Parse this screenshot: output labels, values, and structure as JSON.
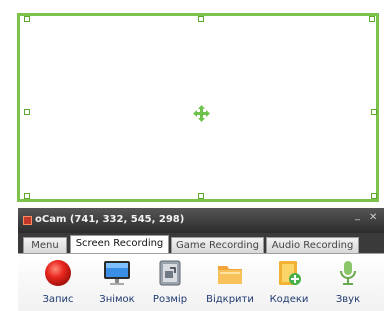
{
  "window": {
    "title": "oCam (741, 332, 545, 298)",
    "minimize_glyph": "_",
    "close_glyph": "✕"
  },
  "tabs": [
    {
      "label": "Menu"
    },
    {
      "label": "Screen Recording",
      "active": true
    },
    {
      "label": "Game Recording"
    },
    {
      "label": "Audio Recording"
    }
  ],
  "toolbar": [
    {
      "label": "Запис",
      "icon": "record-icon"
    },
    {
      "label": "Знімок",
      "icon": "monitor-icon"
    },
    {
      "label": "Розмір",
      "icon": "resize-icon"
    },
    {
      "label": "Відкрити",
      "icon": "folder-icon"
    },
    {
      "label": "Кодеки",
      "icon": "codec-icon"
    },
    {
      "label": "Звук",
      "icon": "microphone-icon"
    }
  ],
  "colors": {
    "region_border": "#7cc24b",
    "record": "#e8261e",
    "accent_green": "#6cc24a"
  }
}
